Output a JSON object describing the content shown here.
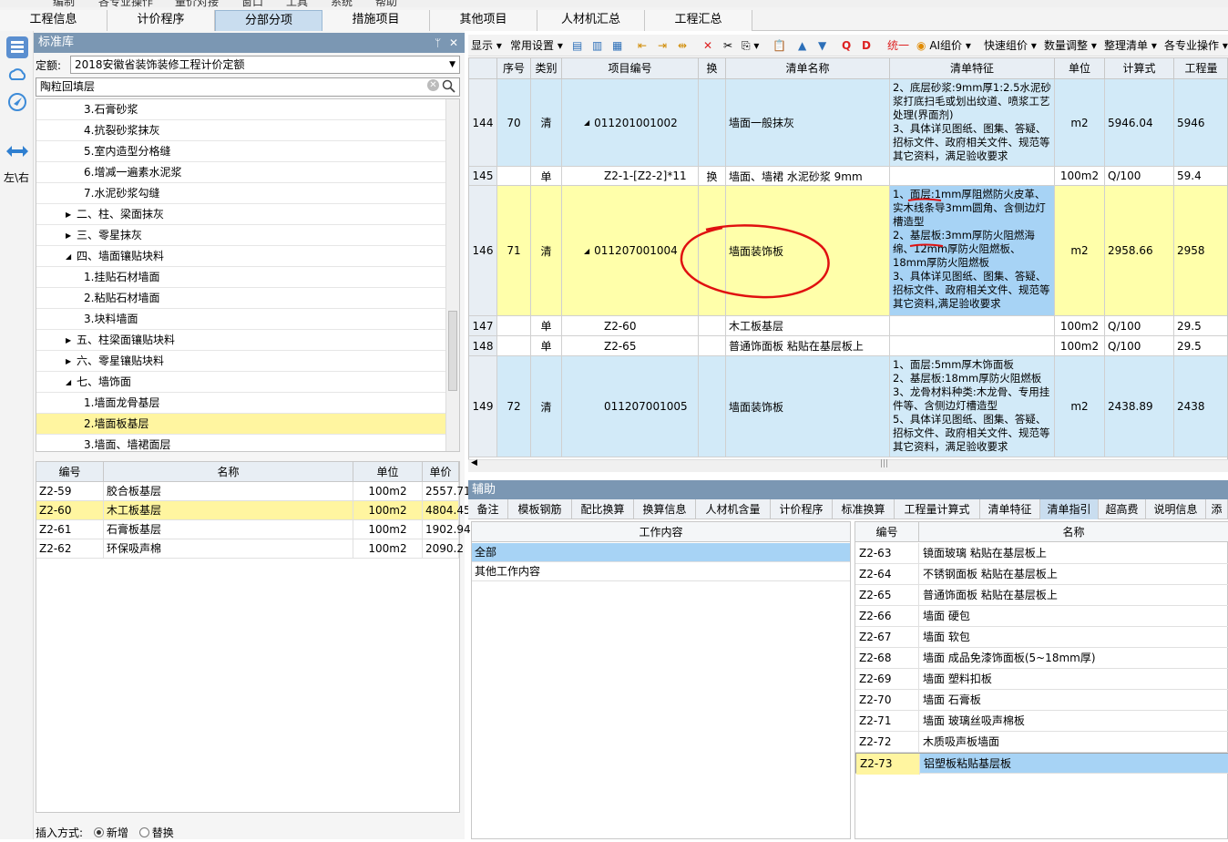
{
  "menubar": [
    "编制",
    "各专业操作",
    "量价对接",
    "窗口",
    "工具",
    "系统",
    "帮助"
  ],
  "main_tabs": [
    {
      "label": "工程信息",
      "active": false
    },
    {
      "label": "计价程序",
      "active": false
    },
    {
      "label": "分部分项",
      "active": true
    },
    {
      "label": "措施项目",
      "active": false
    },
    {
      "label": "其他项目",
      "active": false
    },
    {
      "label": "人材机汇总",
      "active": false
    },
    {
      "label": "工程汇总",
      "active": false
    }
  ],
  "sidebar": {
    "swap_label": "左\\右"
  },
  "library": {
    "title": "标准库",
    "pin": "ᛘ",
    "close": "✕",
    "quota_label": "定额:",
    "quota_value": "2018安徽省装饰装修工程计价定额",
    "search_value": "陶粒回填层",
    "tree": [
      {
        "label": "3.石膏砂浆",
        "level": 2,
        "arrow": ""
      },
      {
        "label": "4.抗裂砂浆抹灰",
        "level": 2,
        "arrow": ""
      },
      {
        "label": "5.室内造型分格缝",
        "level": 2,
        "arrow": ""
      },
      {
        "label": "6.增减一遍素水泥浆",
        "level": 2,
        "arrow": ""
      },
      {
        "label": "7.水泥砂浆勾缝",
        "level": 2,
        "arrow": ""
      },
      {
        "label": "二、柱、梁面抹灰",
        "level": 1,
        "arrow": "▶"
      },
      {
        "label": "三、零星抹灰",
        "level": 1,
        "arrow": "▶"
      },
      {
        "label": "四、墙面镶贴块料",
        "level": 1,
        "arrow": "◢"
      },
      {
        "label": "1.挂贴石材墙面",
        "level": 2,
        "arrow": ""
      },
      {
        "label": "2.粘贴石材墙面",
        "level": 2,
        "arrow": ""
      },
      {
        "label": "3.块料墙面",
        "level": 2,
        "arrow": ""
      },
      {
        "label": "五、柱梁面镶贴块料",
        "level": 1,
        "arrow": "▶"
      },
      {
        "label": "六、零星镶贴块料",
        "level": 1,
        "arrow": "▶"
      },
      {
        "label": "七、墙饰面",
        "level": 1,
        "arrow": "◢"
      },
      {
        "label": "1.墙面龙骨基层",
        "level": 2,
        "arrow": ""
      },
      {
        "label": "2.墙面板基层",
        "level": 2,
        "arrow": "",
        "highlight": true
      },
      {
        "label": "3.墙面、墙裙面层",
        "level": 2,
        "arrow": ""
      }
    ],
    "detail_headers": [
      "编号",
      "名称",
      "单位",
      "单价"
    ],
    "detail_rows": [
      {
        "code": "Z2-59",
        "name": "胶合板基层",
        "unit": "100m2",
        "price": "2557.71"
      },
      {
        "code": "Z2-60",
        "name": "木工板基层",
        "unit": "100m2",
        "price": "4804.45",
        "highlight": true
      },
      {
        "code": "Z2-61",
        "name": "石膏板基层",
        "unit": "100m2",
        "price": "1902.94"
      },
      {
        "code": "Z2-62",
        "name": "环保吸声棉",
        "unit": "100m2",
        "price": "2090.2"
      }
    ],
    "insert_label": "插入方式:",
    "insert_new": "新增",
    "insert_replace": "替换"
  },
  "toolbar": {
    "display": "显示",
    "common_settings": "常用设置",
    "unify": "统一",
    "ai_group": "AI组价",
    "quick_group": "快速组价",
    "qty_adjust": "数量调整",
    "organize": "整理清单",
    "professional": "各专业操作"
  },
  "grid": {
    "headers": [
      "",
      "序号",
      "类别",
      "项目编号",
      "换",
      "清单名称",
      "清单特征",
      "单位",
      "计算式",
      "工程量"
    ],
    "rows": [
      {
        "row": "144",
        "seq": "70",
        "type": "清",
        "arrow": "◢",
        "code": "011201001002",
        "swap": "",
        "name": "墙面一般抹灰",
        "feature": "2、底层砂浆:9mm厚1:2.5水泥砂浆打底扫毛或划出纹道、喷浆工艺处理(界面剂)\n3、具体详见图纸、图集、答疑、招标文件、政府相关文件、规范等其它资料，满足验收要求",
        "unit": "m2",
        "formula": "5946.04",
        "qty": "5946",
        "style": "blue"
      },
      {
        "row": "145",
        "seq": "",
        "type": "单",
        "arrow": "",
        "code": "Z2-1-[Z2-2]*11",
        "swap": "换",
        "name": "墙面、墙裙 水泥砂浆 9mm",
        "feature": "",
        "unit": "100m2",
        "formula": "Q/100",
        "qty": "59.4",
        "style": "white"
      },
      {
        "row": "146",
        "seq": "71",
        "type": "清",
        "arrow": "◢",
        "code": "011207001004",
        "swap": "",
        "name": "墙面装饰板",
        "feature": "1、面层:1mm厚阻燃防火皮革、实木线条导3mm圆角、含侧边灯槽造型\n2、基层板:3mm厚防火阻燃海绵、12mm厚防火阻燃板、18mm厚防火阻燃板\n3、具体详见图纸、图集、答疑、招标文件、政府相关文件、规范等其它资料,满足验收要求",
        "unit": "m2",
        "formula": "2958.66",
        "qty": "2958",
        "style": "yellow"
      },
      {
        "row": "147",
        "seq": "",
        "type": "单",
        "arrow": "",
        "code": "Z2-60",
        "swap": "",
        "name": "木工板基层",
        "feature": "",
        "unit": "100m2",
        "formula": "Q/100",
        "qty": "29.5",
        "style": "white"
      },
      {
        "row": "148",
        "seq": "",
        "type": "单",
        "arrow": "",
        "code": "Z2-65",
        "swap": "",
        "name": "普通饰面板 粘贴在基层板上",
        "feature": "",
        "unit": "100m2",
        "formula": "Q/100",
        "qty": "29.5",
        "style": "white"
      },
      {
        "row": "149",
        "seq": "72",
        "type": "清",
        "arrow": "",
        "code": "011207001005",
        "swap": "",
        "name": "墙面装饰板",
        "feature": "1、面层:5mm厚木饰面板\n2、基层板:18mm厚防火阻燃板\n3、龙骨材料种类:木龙骨、专用挂件等、含侧边灯槽造型\n5、具体详见图纸、图集、答疑、招标文件、政府相关文件、规范等其它资料，满足验收要求",
        "unit": "m2",
        "formula": "2438.89",
        "qty": "2438",
        "style": "blue"
      }
    ],
    "scroll_grip": "|||"
  },
  "aux": {
    "title": "辅助",
    "tabs": [
      {
        "label": "备注",
        "active": false
      },
      {
        "label": "模板钢筋",
        "active": false
      },
      {
        "label": "配比换算",
        "active": false
      },
      {
        "label": "换算信息",
        "active": false
      },
      {
        "label": "人材机含量",
        "active": false
      },
      {
        "label": "计价程序",
        "active": false
      },
      {
        "label": "标准换算",
        "active": false
      },
      {
        "label": "工程量计算式",
        "active": false
      },
      {
        "label": "清单特征",
        "active": false
      },
      {
        "label": "清单指引",
        "active": true
      },
      {
        "label": "超高费",
        "active": false
      },
      {
        "label": "说明信息",
        "active": false
      },
      {
        "label": "添",
        "active": false
      }
    ],
    "work_header": "工作内容",
    "work_items": [
      {
        "label": "全部",
        "selected": true
      },
      {
        "label": "其他工作内容",
        "selected": false
      }
    ],
    "code_headers": [
      "编号",
      "名称"
    ],
    "code_items": [
      {
        "code": "Z2-63",
        "name": "镜面玻璃 粘贴在基层板上"
      },
      {
        "code": "Z2-64",
        "name": "不锈钢面板 粘贴在基层板上"
      },
      {
        "code": "Z2-65",
        "name": "普通饰面板 粘贴在基层板上"
      },
      {
        "code": "Z2-66",
        "name": "墙面 硬包"
      },
      {
        "code": "Z2-67",
        "name": "墙面 软包"
      },
      {
        "code": "Z2-68",
        "name": "墙面 成品免漆饰面板(5~18mm厚)"
      },
      {
        "code": "Z2-69",
        "name": "墙面 塑料扣板"
      },
      {
        "code": "Z2-70",
        "name": "墙面 石膏板"
      },
      {
        "code": "Z2-71",
        "name": "墙面 玻璃丝吸声棉板"
      },
      {
        "code": "Z2-72",
        "name": "木质吸声板墙面"
      },
      {
        "code": "Z2-73",
        "name": "铝塑板粘贴基层板",
        "selected": true
      }
    ]
  }
}
